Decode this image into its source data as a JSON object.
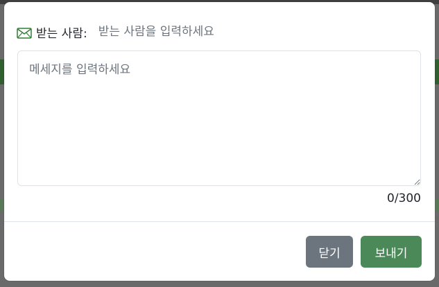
{
  "modal": {
    "recipient": {
      "icon": "envelope-icon",
      "label": "받는 사람:",
      "placeholder": "받는 사람을 입력하세요",
      "value": ""
    },
    "message": {
      "placeholder": "메세지를 입력하세요",
      "value": ""
    },
    "counter": "0/300",
    "buttons": {
      "close_label": "닫기",
      "send_label": "보내기"
    },
    "colors": {
      "close_button": "#6c757d",
      "send_button": "#4b8a58",
      "icon": "#2e7d32"
    }
  }
}
